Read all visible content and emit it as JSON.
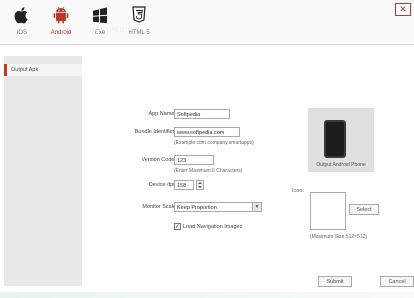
{
  "platforms": [
    {
      "label": "iOS",
      "icon": "apple-icon"
    },
    {
      "label": "Android",
      "icon": "android-icon"
    },
    {
      "label": "Exe",
      "icon": "windows-icon"
    },
    {
      "label": "HTML 5",
      "icon": "html5-icon"
    }
  ],
  "close_label": "✕",
  "watermark": "SOFTPEDIA",
  "sidebar": {
    "items": [
      {
        "label": "Output Apk"
      }
    ]
  },
  "form": {
    "app_name_label": "App Name:",
    "app_name_value": "Softpedia",
    "bundle_label": "Bundle Identifier:",
    "bundle_value": "www.softpedia.com",
    "bundle_hint": "(Example:com.company.smartapps)",
    "version_label": "Version Code:",
    "version_value": "123",
    "version_hint": "(Enter Maximum 6 Characters)",
    "dpi_label": "Device dpi:",
    "dpi_value": "158",
    "scale_label": "Monitor Scale",
    "scale_value": "Keep Proportion",
    "load_nav_label": "Load Navigation Images",
    "load_nav_checked": true
  },
  "preview": {
    "caption": "Output Android Phone"
  },
  "icon_section": {
    "label": "Icon:",
    "select_button": "Select",
    "size_hint": "(Maximum Size:512×512)"
  },
  "footer": {
    "submit": "Submit",
    "cancel": "Cancel"
  },
  "colors": {
    "accent": "#c0392b"
  }
}
